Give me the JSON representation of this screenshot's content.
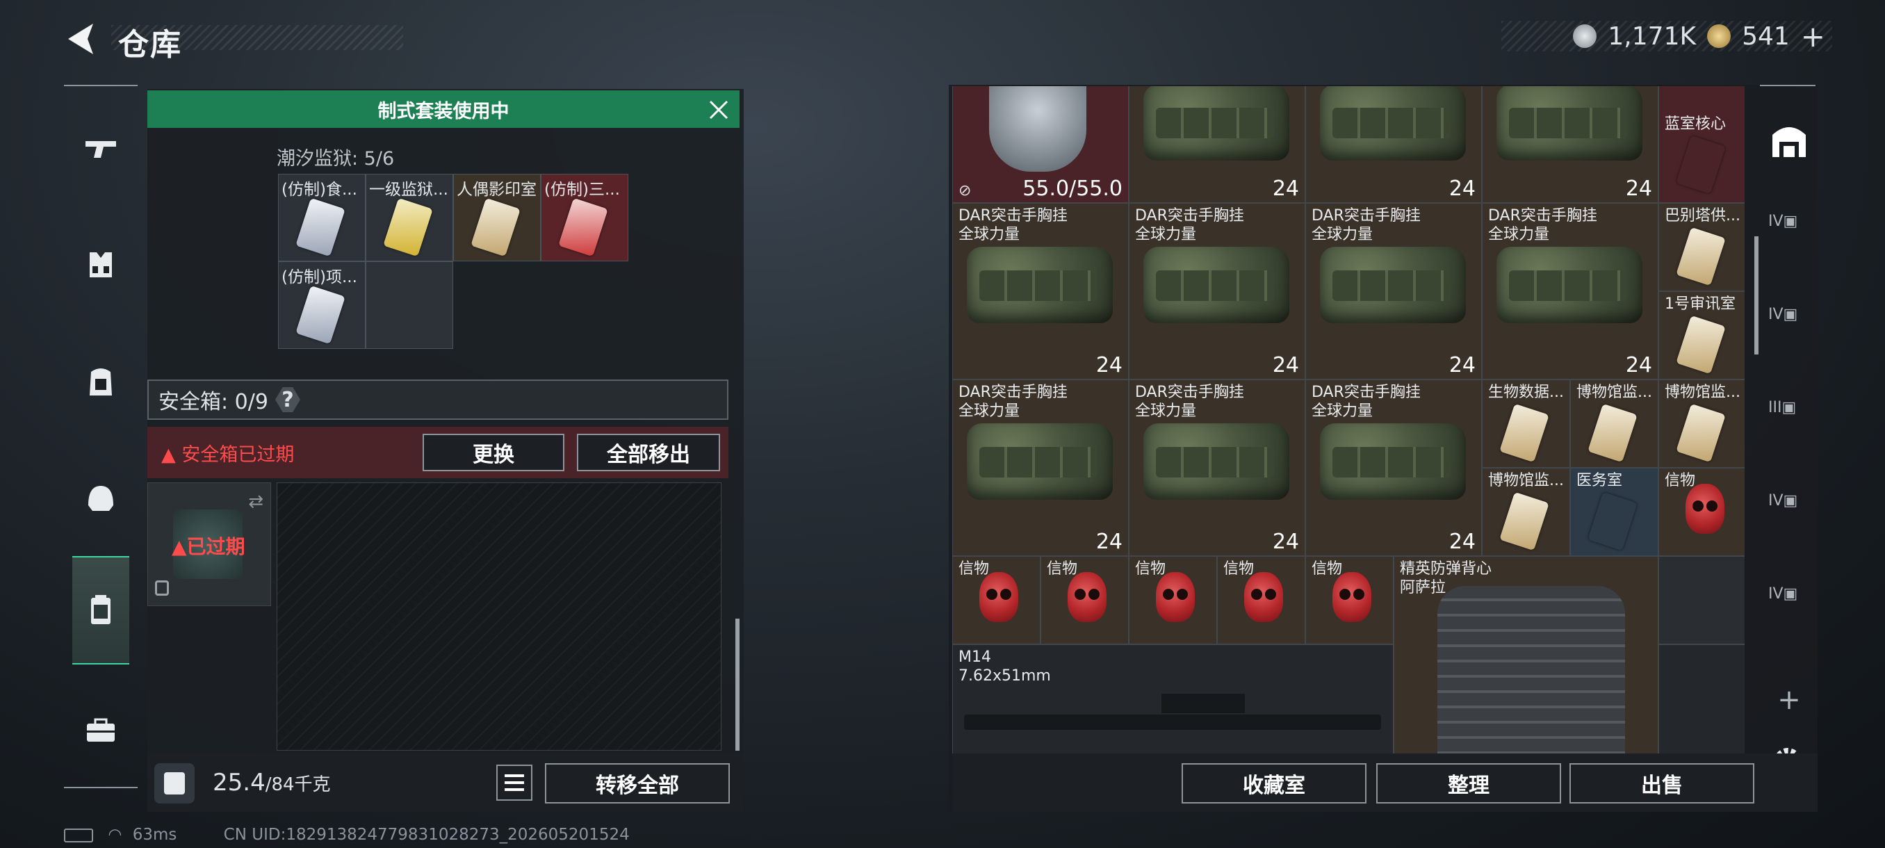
{
  "header": {
    "title": "仓库",
    "coins": [
      {
        "icon": "silver-coin-icon",
        "value": "1,171K"
      },
      {
        "icon": "gold-coin-icon",
        "value": "541"
      }
    ],
    "plus": "+"
  },
  "nav": {
    "items": [
      "weapon-icon",
      "vest-icon",
      "backpack-icon",
      "helmet-icon",
      "case-icon",
      "toolbox-icon"
    ],
    "active": "case-icon"
  },
  "left": {
    "banner": "制式套装使用中",
    "prison_label": "潮汐监狱: 5/6",
    "cards": [
      {
        "label": "(仿制)食...",
        "color": "#c9d0dc"
      },
      {
        "label": "一级监狱...",
        "color": "#d8c244"
      },
      {
        "label": "人偶影印室",
        "color": "#d9c7a0"
      },
      {
        "label": "(仿制)三...",
        "color": "#cf3b3b"
      },
      {
        "label": "(仿制)项...",
        "color": "#c9d0dc"
      }
    ],
    "safe_box": "安全箱: 0/9",
    "qmark": "?",
    "warning": "安全箱已过期",
    "replace_btn": "更换",
    "remove_all_btn": "全部移出",
    "expired": "已过期",
    "weight": "25.4",
    "weight_max": "/84千克",
    "transfer_btn": "转移全部"
  },
  "right": {
    "top_row": {
      "helmet_dur": "55.0/55.0",
      "qty": "24",
      "card": "蓝室核心"
    },
    "vest_name1": "DAR突击手胸挂",
    "vest_name2": "全球力量",
    "qty": "24",
    "cards_col": [
      "巴别塔供...",
      "1号审讯室"
    ],
    "cards_row3": [
      "生物数据...",
      "博物馆监...",
      "博物馆监..."
    ],
    "cards_row4": [
      "博物馆监...",
      "医务室",
      "信物"
    ],
    "token": "信物",
    "armor1": "精英防弹背心",
    "armor2": "阿萨拉",
    "gun1": "M14",
    "gun2": "7.62x51mm",
    "btn_collection": "收藏室",
    "btn_sort": "整理",
    "btn_sell": "出售",
    "side_plus": "+"
  },
  "status": {
    "ping": "63ms",
    "uid": "CN UID:182913824779831028273_202605201524"
  }
}
